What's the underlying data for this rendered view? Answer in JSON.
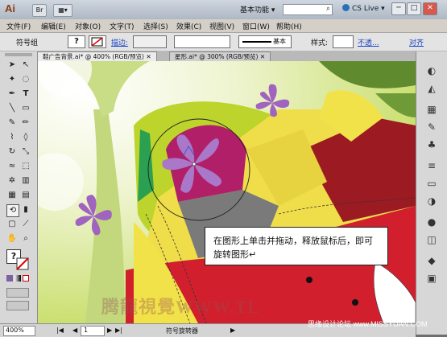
{
  "titlebar": {
    "app_logo": "Ai",
    "workspace": "基本功能",
    "cs_live": "CS Live",
    "minimize": "─",
    "maximize": "□",
    "close": "✕"
  },
  "menubar": {
    "items": [
      "文件(F)",
      "编辑(E)",
      "对象(O)",
      "文字(T)",
      "选择(S)",
      "效果(C)",
      "视图(V)",
      "窗口(W)",
      "帮助(H)"
    ]
  },
  "controlbar": {
    "selection_label": "符号组",
    "fill_glyph": "?",
    "stroke_label": "描边:",
    "brush_label": "基本",
    "style_label": "样式:",
    "opacity_label": "不透...",
    "align_label": "对齐"
  },
  "tabs": [
    "鞋广告背景.ai* @ 400% (RGB/预览)",
    "星形.ai* @ 300% (RGB/预览)"
  ],
  "tools": {
    "icons": [
      "selection-icon",
      "direct-selection-icon",
      "magic-wand-icon",
      "lasso-icon",
      "pen-icon",
      "type-icon",
      "line-icon",
      "rectangle-icon",
      "brush-icon",
      "pencil-icon",
      "blob-brush-icon",
      "eraser-icon",
      "rotate-icon",
      "scale-icon",
      "warp-icon",
      "free-transform-icon",
      "symbol-sprayer-icon",
      "graph-icon",
      "mesh-icon",
      "gradient-icon",
      "eyedropper-icon",
      "blend-icon",
      "symbol-spin-icon",
      "column-graph-icon",
      "artboard-icon",
      "slice-icon",
      "hand-icon",
      "zoom-icon"
    ],
    "fill_glyph": "?"
  },
  "right_panel": {
    "icons": [
      "color-icon",
      "color-guide-icon",
      "swatches-icon",
      "brushes-icon",
      "symbols-icon",
      "stroke-icon",
      "gradient-icon",
      "transparency-icon",
      "appearance-icon",
      "graphic-styles-icon",
      "layers-icon",
      "artboards-icon"
    ]
  },
  "callout": {
    "text": "在图形上单击并拖动，释放鼠标后，即可旋转图形↵"
  },
  "statusbar": {
    "zoom": "400%",
    "page": "1",
    "tool_name": "符号旋转器"
  },
  "watermarks": {
    "left": "腾龍視覺WWW.TL",
    "right": "思缘设计论坛 www.MISSYUAN.COM"
  },
  "colors": {
    "flower": "#a063bf",
    "green_bg": "#bcd42b",
    "red": "#d11f2d",
    "magenta": "#b21f69",
    "yellow": "#f0dd4a",
    "dark_red": "#9c1a22"
  }
}
